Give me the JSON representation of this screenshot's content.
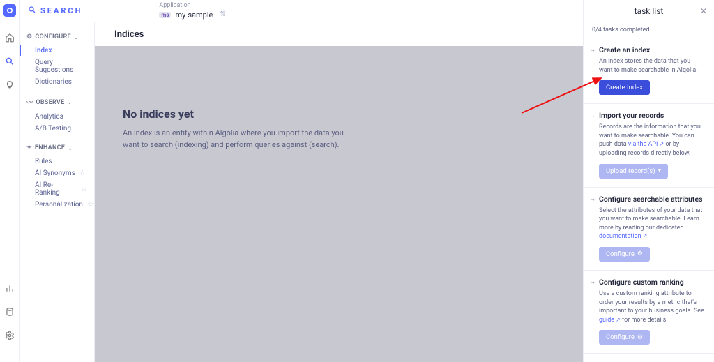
{
  "brand": {
    "name": "SEARCH"
  },
  "application": {
    "label": "Application",
    "name": "my-sample",
    "tag": "ms"
  },
  "sidebar": {
    "sections": [
      {
        "title": "CONFIGURE",
        "icon": "gear",
        "items": [
          {
            "label": "Index",
            "active": true
          },
          {
            "label": "Query Suggestions"
          },
          {
            "label": "Dictionaries"
          }
        ]
      },
      {
        "title": "OBSERVE",
        "icon": "pulse",
        "items": [
          {
            "label": "Analytics"
          },
          {
            "label": "A/B Testing"
          }
        ]
      },
      {
        "title": "ENHANCE",
        "icon": "sparkle",
        "items": [
          {
            "label": "Rules"
          },
          {
            "label": "AI Synonyms",
            "star": true
          },
          {
            "label": "AI Re-Ranking",
            "star": true
          },
          {
            "label": "Personalization",
            "star": true
          }
        ]
      }
    ]
  },
  "main": {
    "page_title": "Indices",
    "empty": {
      "title": "No indices yet",
      "body": "An index is an entity within Algolia where you import the data you want to search (indexing) and perform queries against (search)."
    }
  },
  "panel": {
    "title": "task list",
    "progress": "0/4 tasks completed",
    "tasks": [
      {
        "title": "Create an index",
        "desc_pre": "An index stores the data that you want to make searchable in Algolia.",
        "link": "",
        "desc_post": "",
        "button": "Create Index",
        "button_icon": "",
        "primary": true
      },
      {
        "title": "Import your records",
        "desc_pre": "Records are the information that you want to make searchable. You can push data ",
        "link": "via the API",
        "desc_post": " or by uploading records directly below.",
        "button": "Upload record(s)",
        "button_icon": "▾",
        "primary": false
      },
      {
        "title": "Configure searchable attributes",
        "desc_pre": "Select the attributes of your data that you want to make searchable. Learn more by reading our dedicated ",
        "link": "documentation",
        "desc_post": ".",
        "button": "Configure",
        "button_icon": "⚙",
        "primary": false
      },
      {
        "title": "Configure custom ranking",
        "desc_pre": "Use a custom ranking attribute to order your results by a metric that's important to your business goals. See ",
        "link": "guide",
        "desc_post": " for more details.",
        "button": "Configure",
        "button_icon": "⚙",
        "primary": false
      }
    ]
  }
}
